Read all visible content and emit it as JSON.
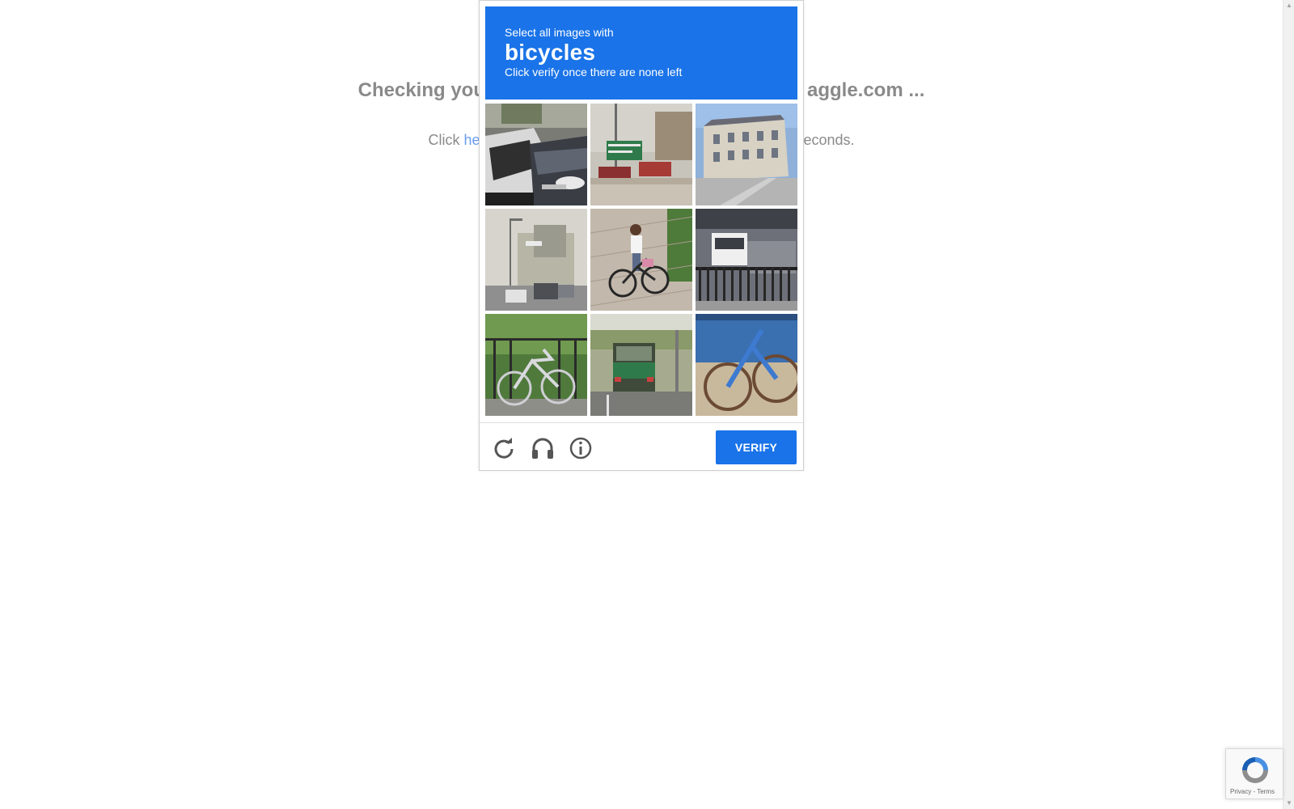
{
  "background": {
    "heading_left": "Checking you",
    "heading_right": "aggle.com ...",
    "line_prefix": "Click ",
    "line_link": "he",
    "line_suffix": "econds."
  },
  "captcha": {
    "instruction_small": "Select all images with",
    "target_object": "bicycles",
    "instruction_sub": "Click verify once there are none left",
    "tiles": [
      {
        "label": "cars-on-street"
      },
      {
        "label": "road-sign-trucks"
      },
      {
        "label": "building-street"
      },
      {
        "label": "street-traffic"
      },
      {
        "label": "girl-on-bicycle"
      },
      {
        "label": "parking-fence"
      },
      {
        "label": "bicycle-by-fence"
      },
      {
        "label": "truck-on-road"
      },
      {
        "label": "blue-bicycle"
      }
    ],
    "verify_label": "VERIFY",
    "accent_color": "#1a73e8"
  },
  "badge": {
    "links": "Privacy - Terms"
  }
}
